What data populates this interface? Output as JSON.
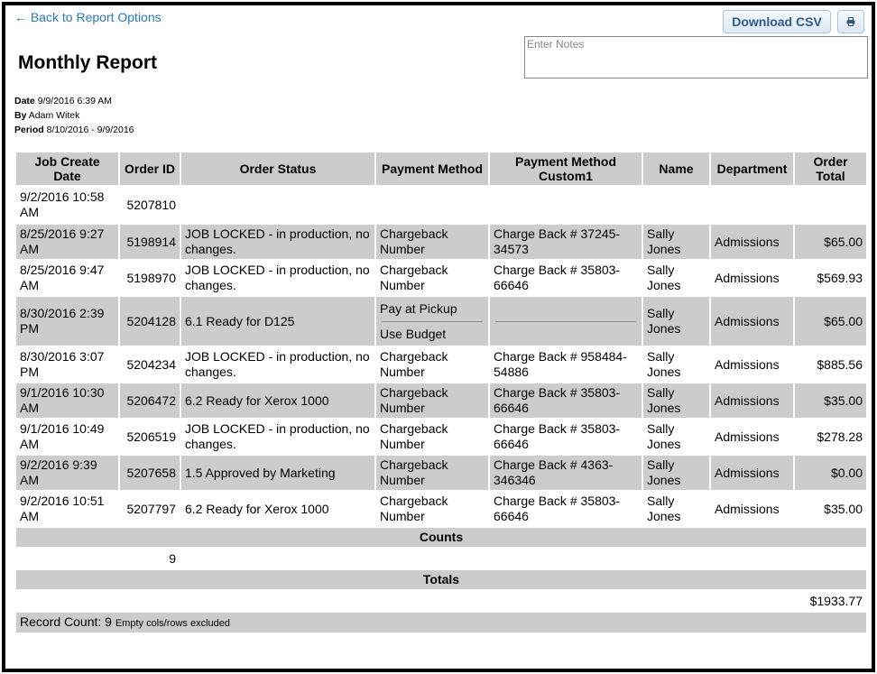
{
  "nav": {
    "back_label": "← Back to Report Options"
  },
  "toolbar": {
    "csv_label": "Download CSV",
    "print_icon": "printer-icon"
  },
  "notes": {
    "placeholder": "Enter Notes",
    "value": ""
  },
  "report": {
    "title": "Monthly Report",
    "date_label": "Date",
    "date_value": "9/9/2016 6:39 AM",
    "by_label": "By",
    "by_value": "Adam Witek",
    "period_label": "Period",
    "period_value": "8/10/2016 - 9/9/2016"
  },
  "table": {
    "headers": [
      "Job Create Date",
      "Order ID",
      "Order Status",
      "Payment Method",
      "Payment Method Custom1",
      "Name",
      "Department",
      "Order Total"
    ],
    "rows": [
      {
        "date": "9/2/2016 10:58 AM",
        "id": "5207810",
        "status": "",
        "method": "",
        "custom": "",
        "name": "",
        "dept": "",
        "total": ""
      },
      {
        "date": "8/25/2016 9:27 AM",
        "id": "5198914",
        "status": "JOB LOCKED - in production, no changes.",
        "method": "Chargeback Number",
        "custom": "Charge Back # 37245-34573",
        "name": "Sally Jones",
        "dept": "Admissions",
        "total": "$65.00"
      },
      {
        "date": "8/25/2016 9:47 AM",
        "id": "5198970",
        "status": "JOB LOCKED - in production, no changes.",
        "method": "Chargeback Number",
        "custom": "Charge Back # 35803-66646",
        "name": "Sally Jones",
        "dept": "Admissions",
        "total": "$569.93"
      },
      {
        "date": "8/30/2016 2:39 PM",
        "id": "5204128",
        "status": "6.1 Ready for D125",
        "method_top": "Pay at Pickup",
        "method_bottom": "Use Budget",
        "custom": "",
        "name": "Sally Jones",
        "dept": "Admissions",
        "total": "$65.00"
      },
      {
        "date": "8/30/2016 3:07 PM",
        "id": "5204234",
        "status": "JOB LOCKED - in production, no changes.",
        "method": "Chargeback Number",
        "custom": "Charge Back # 958484-54886",
        "name": "Sally Jones",
        "dept": "Admissions",
        "total": "$885.56"
      },
      {
        "date": "9/1/2016 10:30 AM",
        "id": "5206472",
        "status": "6.2 Ready for Xerox 1000",
        "method": "Chargeback Number",
        "custom": "Charge Back # 35803-66646",
        "name": "Sally Jones",
        "dept": "Admissions",
        "total": "$35.00"
      },
      {
        "date": "9/1/2016 10:49 AM",
        "id": "5206519",
        "status": "JOB LOCKED - in production, no changes.",
        "method": "Chargeback Number",
        "custom": "Charge Back # 35803-66646",
        "name": "Sally Jones",
        "dept": "Admissions",
        "total": "$278.28"
      },
      {
        "date": "9/2/2016 9:39 AM",
        "id": "5207658",
        "status": "1.5 Approved by Marketing",
        "method": "Chargeback Number",
        "custom": "Charge Back # 4363-346346",
        "name": "Sally Jones",
        "dept": "Admissions",
        "total": "$0.00"
      },
      {
        "date": "9/2/2016 10:51 AM",
        "id": "5207797",
        "status": "6.2 Ready for Xerox 1000",
        "method": "Chargeback Number",
        "custom": "Charge Back # 35803-66646",
        "name": "Sally Jones",
        "dept": "Admissions",
        "total": "$35.00"
      }
    ],
    "counts_label": "Counts",
    "counts_value": "9",
    "totals_label": "Totals",
    "totals_value": "$1933.77",
    "record_count_label": "Record Count: 9",
    "record_count_note": "Empty cols/rows excluded"
  }
}
